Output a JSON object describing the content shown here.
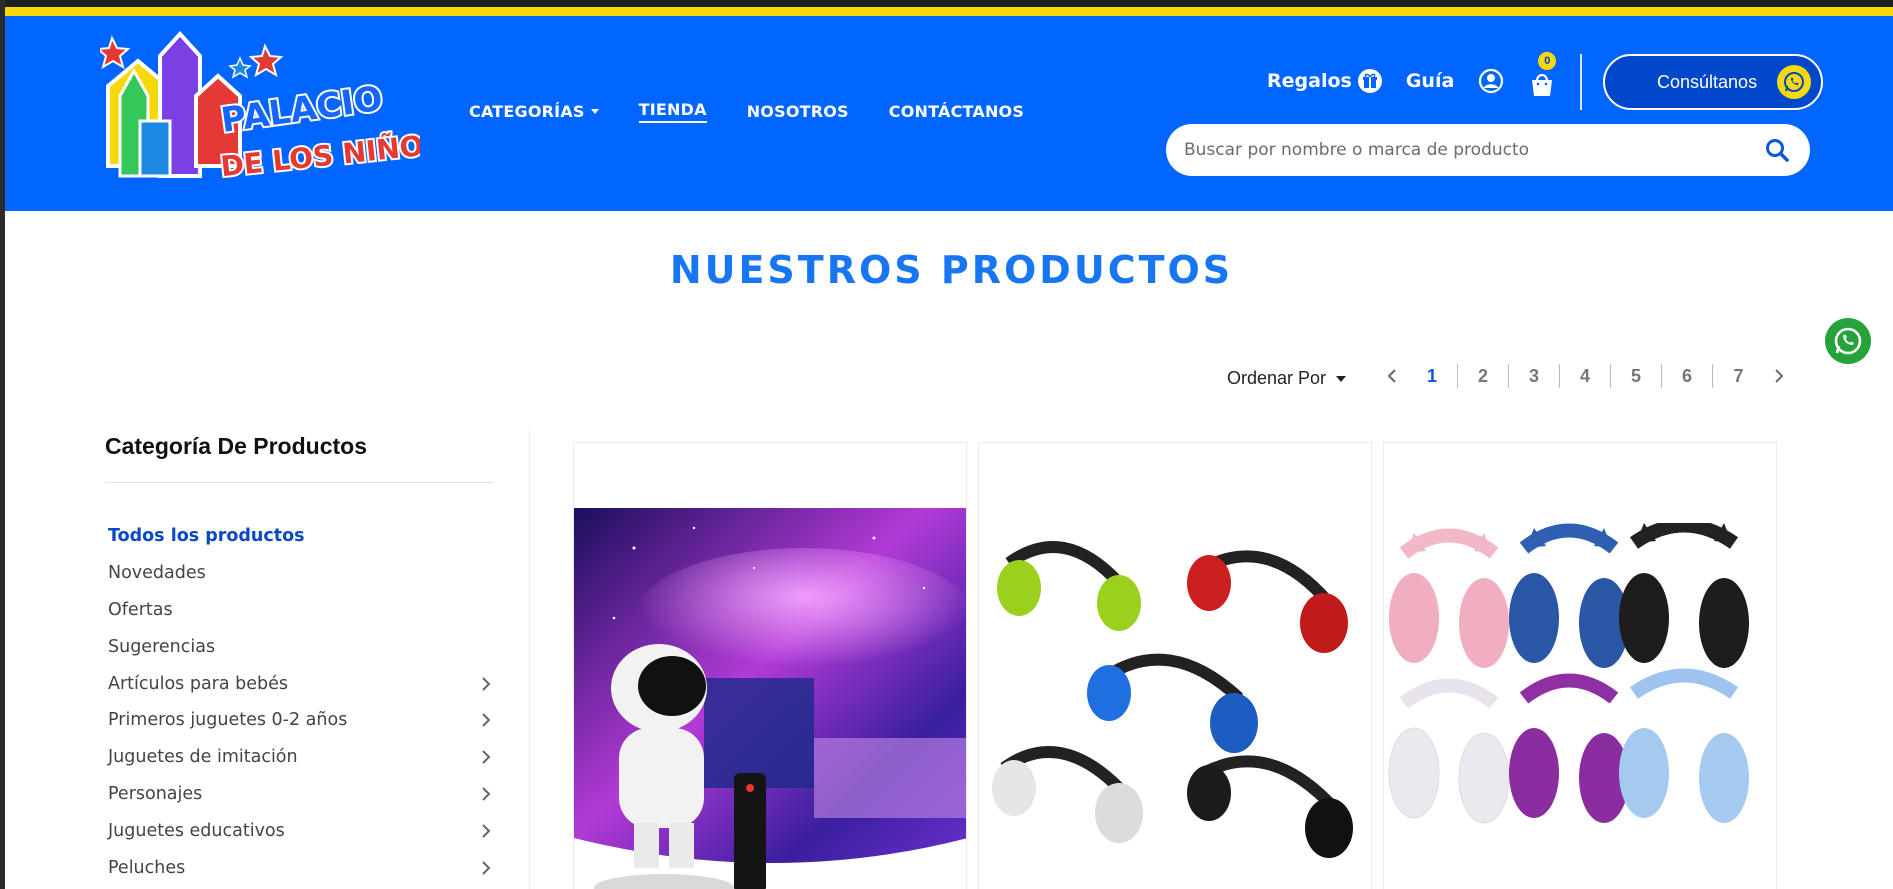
{
  "header": {
    "logo": {
      "brand_line1": "PALACIO",
      "brand_line2": "DE LOS NIÑOS"
    },
    "nav": [
      {
        "label": "CATEGORÍAS",
        "dropdown": true
      },
      {
        "label": "TIENDA",
        "active": true
      },
      {
        "label": "NOSOTROS"
      },
      {
        "label": "CONTÁCTANOS"
      }
    ],
    "links": {
      "gifts": "Regalos",
      "guide": "Guía"
    },
    "cart_count": "0",
    "consult_label": "Consúltanos",
    "search_placeholder": "Buscar por nombre o marca de producto"
  },
  "page": {
    "title": "NUESTROS PRODUCTOS",
    "sort_label": "Ordenar Por",
    "pagination": {
      "pages": [
        "1",
        "2",
        "3",
        "4",
        "5",
        "6",
        "7"
      ],
      "current": "1"
    }
  },
  "sidebar": {
    "title": "Categoría De Productos",
    "items": [
      {
        "label": "Todos los productos",
        "active": true,
        "has_children": false
      },
      {
        "label": "Novedades",
        "has_children": false
      },
      {
        "label": "Ofertas",
        "has_children": false
      },
      {
        "label": "Sugerencias",
        "has_children": false
      },
      {
        "label": "Artículos para bebés",
        "has_children": true
      },
      {
        "label": "Primeros juguetes 0-2 años",
        "has_children": true
      },
      {
        "label": "Juguetes de imitación",
        "has_children": true
      },
      {
        "label": "Personajes",
        "has_children": true
      },
      {
        "label": "Juguetes educativos",
        "has_children": true
      },
      {
        "label": "Peluches",
        "has_children": true
      }
    ]
  },
  "colors": {
    "header_bg": "#0066ff",
    "accent_yellow": "#f5d90a",
    "title_blue": "#1976f2",
    "active_link": "#0b49c4",
    "whatsapp_green": "#25a33a"
  }
}
